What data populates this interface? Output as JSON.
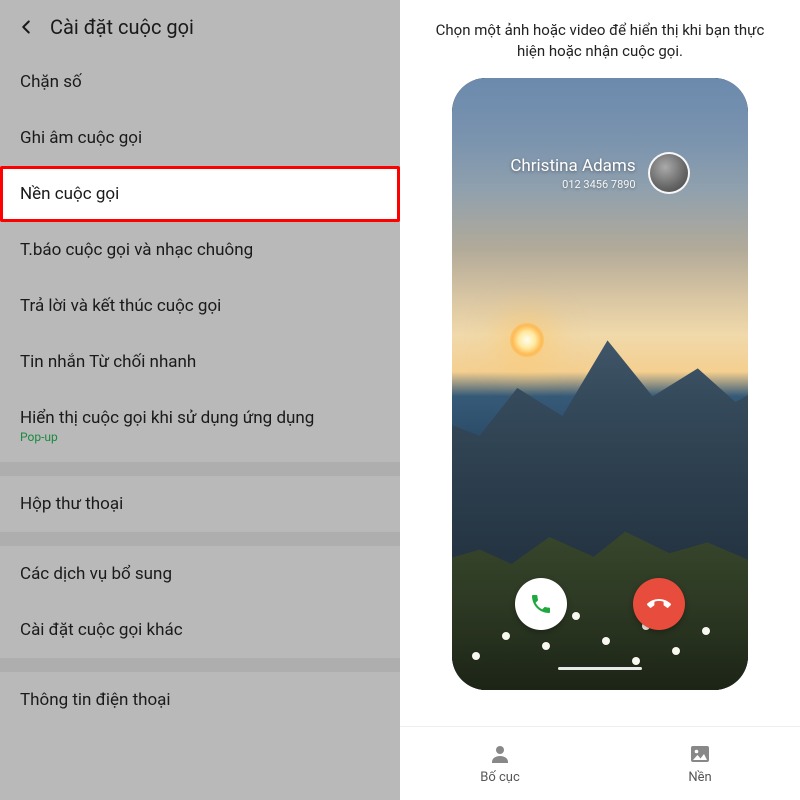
{
  "left": {
    "title": "Cài đặt cuộc gọi",
    "items": [
      {
        "label": "Chặn số"
      },
      {
        "label": "Ghi âm cuộc gọi"
      },
      {
        "label": "Nền cuộc gọi",
        "highlighted": true
      },
      {
        "label": "T.báo cuộc gọi và nhạc chuông"
      },
      {
        "label": "Trả lời và kết thúc cuộc gọi"
      },
      {
        "label": "Tin nhắn Từ chối nhanh"
      },
      {
        "label": "Hiển thị cuộc gọi khi sử dụng ứng dụng",
        "sub": "Pop-up"
      }
    ],
    "group2": [
      {
        "label": "Hộp thư thoại"
      }
    ],
    "group3": [
      {
        "label": "Các dịch vụ bổ sung"
      },
      {
        "label": "Cài đặt cuộc gọi khác"
      }
    ],
    "group4": [
      {
        "label": "Thông tin điện thoại"
      }
    ]
  },
  "right": {
    "instruction": "Chọn một ảnh hoặc video để hiển thị khi bạn thực hiện hoặc nhận cuộc gọi.",
    "caller_name": "Christina Adams",
    "caller_number": "012 3456 7890",
    "tabs": {
      "layout": "Bố cục",
      "background": "Nền"
    }
  }
}
